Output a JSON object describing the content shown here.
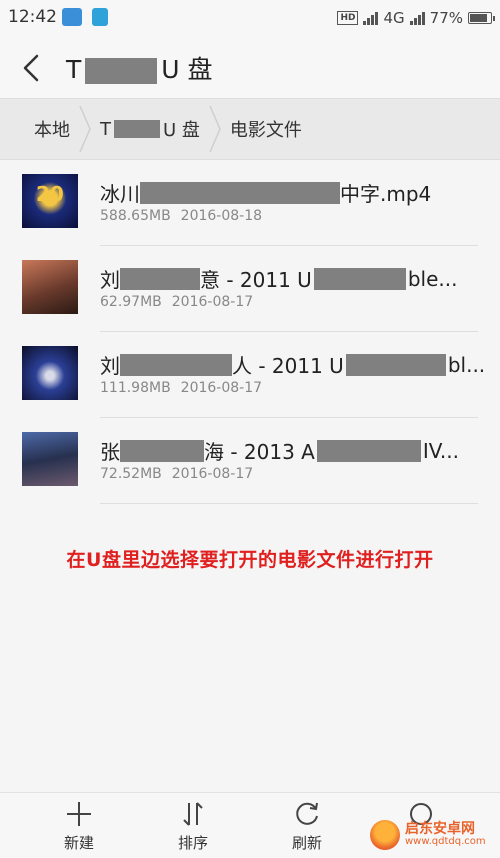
{
  "status_bar": {
    "time": "12:42",
    "network": "4G",
    "battery": "77%"
  },
  "title_bar": {
    "title_prefix": "T",
    "title_suffix": "U 盘"
  },
  "breadcrumb": {
    "items": [
      {
        "label": "本地"
      },
      {
        "label_prefix": "T",
        "label_suffix": "U 盘"
      },
      {
        "label": "电影文件"
      }
    ]
  },
  "files": [
    {
      "name_prefix": "冰川",
      "name_suffix": "中字.mp4",
      "size": "588.65MB",
      "date": "2016-08-18",
      "thumb": "20th-century-fox-logo"
    },
    {
      "name_prefix": "刘",
      "name_suffix": "意 - 2011 U",
      "name_tail": "ble...",
      "size": "62.97MB",
      "date": "2016-08-17",
      "thumb": "singer-portrait"
    },
    {
      "name_prefix": "刘",
      "name_suffix": "人 - 2011 U",
      "name_tail": "bl...",
      "size": "111.98MB",
      "date": "2016-08-17",
      "thumb": "concert-stage"
    },
    {
      "name_prefix": "张",
      "name_suffix": "海 - 2013 A",
      "name_tail": "IV...",
      "size": "72.52MB",
      "date": "2016-08-17",
      "thumb": "studio-keyboard"
    }
  ],
  "annotation": "在U盘里边选择要打开的电影文件进行打开",
  "toolbar": {
    "new_label": "新建",
    "sort_label": "排序",
    "refresh_label": "刷新"
  },
  "watermark": {
    "name": "启东安卓网",
    "url": "www.qdtdq.com"
  },
  "colors": {
    "annotation": "#e01f1f",
    "background": "#f5f5f5",
    "breadcrumb_bg": "#e9e9e9"
  }
}
